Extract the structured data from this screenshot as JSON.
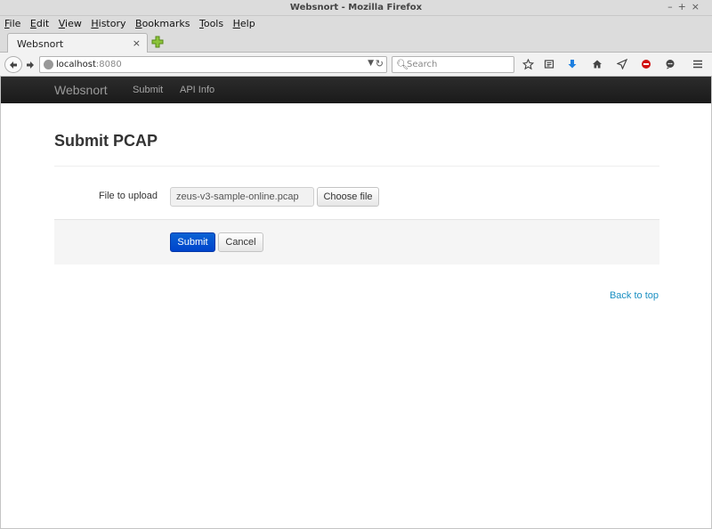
{
  "window": {
    "title": "Websnort - Mozilla Firefox",
    "controls": [
      "–",
      "+",
      "×"
    ]
  },
  "menubar": [
    {
      "label": "File",
      "accel": "F",
      "rest": "ile"
    },
    {
      "label": "Edit",
      "accel": "E",
      "rest": "dit"
    },
    {
      "label": "View",
      "accel": "V",
      "rest": "iew"
    },
    {
      "label": "History",
      "accel": "H",
      "rest": "istory"
    },
    {
      "label": "Bookmarks",
      "accel": "B",
      "rest": "ookmarks"
    },
    {
      "label": "Tools",
      "accel": "T",
      "rest": "ools"
    },
    {
      "label": "Help",
      "accel": "H",
      "rest": "elp"
    }
  ],
  "tab": {
    "label": "Websnort",
    "close": "×"
  },
  "nav": {
    "url_host": "localhost",
    "url_port": ":8080",
    "search_placeholder": "Search"
  },
  "toolbar_icons": [
    "star-icon",
    "reading-list-icon",
    "download-icon",
    "home-icon",
    "send-icon",
    "block-icon",
    "chat-icon",
    "menu-icon"
  ],
  "site": {
    "brand": "Websnort",
    "nav": [
      "Submit",
      "API Info"
    ]
  },
  "main": {
    "title": "Submit PCAP",
    "file_label": "File to upload",
    "file_value": "zeus-v3-sample-online.pcap",
    "choose_file": "Choose file",
    "submit": "Submit",
    "cancel": "Cancel",
    "back_to_top": "Back to top"
  },
  "colors": {
    "navbar": "#1b1b1b",
    "primary_button": "#0044cc",
    "link": "#1a8fc2",
    "download_icon": "#1e7fe0",
    "block_icon": "#d01010",
    "newtab_icon": "#7ab317"
  }
}
